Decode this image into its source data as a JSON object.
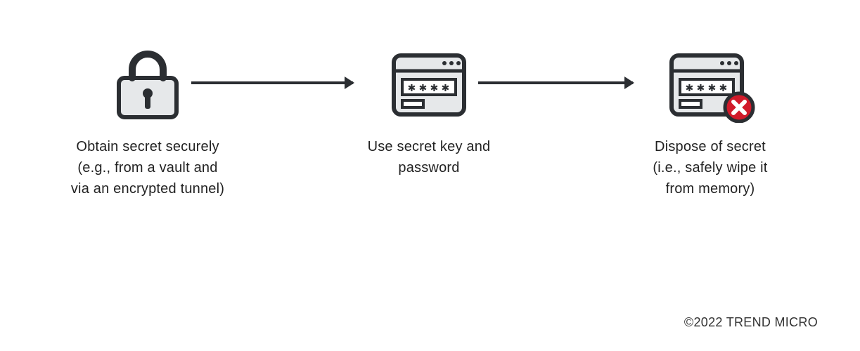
{
  "steps": [
    {
      "icon": "lock-icon",
      "caption_line1": "Obtain secret securely",
      "caption_line2": "(e.g., from a vault and",
      "caption_line3": "via an encrypted tunnel)"
    },
    {
      "icon": "password-window-icon",
      "caption_line1": "Use secret key and",
      "caption_line2": "password",
      "caption_line3": ""
    },
    {
      "icon": "password-window-delete-icon",
      "caption_line1": "Dispose of secret",
      "caption_line2": "(i.e., safely wipe it",
      "caption_line3": "from memory)"
    }
  ],
  "footer": "©2022 TREND MICRO",
  "colors": {
    "stroke": "#2b2e32",
    "fill_light": "#e6e8ea",
    "badge_red": "#d11a2a",
    "badge_x": "#ffffff"
  }
}
